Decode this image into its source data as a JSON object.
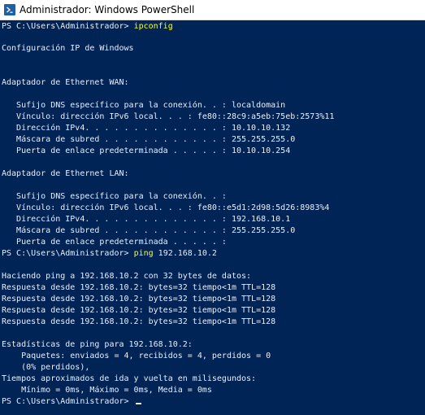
{
  "window": {
    "title": "Administrador: Windows PowerShell",
    "icon": "powershell-icon"
  },
  "console": {
    "prompt": "PS C:\\Users\\Administrador> ",
    "cmd1": "ipconfig",
    "cmd2": "ping",
    "cmd2_args": " 192.168.10.2",
    "lines": [
      "",
      "Configuración IP de Windows",
      "",
      "",
      "Adaptador de Ethernet WAN:",
      "",
      "   Sufijo DNS específico para la conexión. . : localdomain",
      "   Vínculo: dirección IPv6 local. . . : fe80::28c9:a5eb:75eb:2573%11",
      "   Dirección IPv4. . . . . . . . . . . . . . : 10.10.10.132",
      "   Máscara de subred . . . . . . . . . . . . : 255.255.255.0",
      "   Puerta de enlace predeterminada . . . . . : 10.10.10.254",
      "",
      "Adaptador de Ethernet LAN:",
      "",
      "   Sufijo DNS específico para la conexión. . :",
      "   Vínculo: dirección IPv6 local. . . : fe80::e5d1:2d98:5d26:8983%4",
      "   Dirección IPv4. . . . . . . . . . . . . . : 192.168.10.1",
      "   Máscara de subred . . . . . . . . . . . . : 255.255.255.0",
      "   Puerta de enlace predeterminada . . . . . :",
      "",
      "Haciendo ping a 192.168.10.2 con 32 bytes de datos:",
      "Respuesta desde 192.168.10.2: bytes=32 tiempo<1m TTL=128",
      "Respuesta desde 192.168.10.2: bytes=32 tiempo<1m TTL=128",
      "Respuesta desde 192.168.10.2: bytes=32 tiempo<1m TTL=128",
      "Respuesta desde 192.168.10.2: bytes=32 tiempo<1m TTL=128",
      "",
      "Estadísticas de ping para 192.168.10.2:",
      "    Paquetes: enviados = 4, recibidos = 4, perdidos = 0",
      "    (0% perdidos),",
      "Tiempos aproximados de ida y vuelta en milisegundos:",
      "    Mínimo = 0ms, Máximo = 0ms, Media = 0ms"
    ]
  },
  "colors": {
    "console_bg": "#012456",
    "console_text": "#eeedf0",
    "command_text": "#ffff00"
  }
}
